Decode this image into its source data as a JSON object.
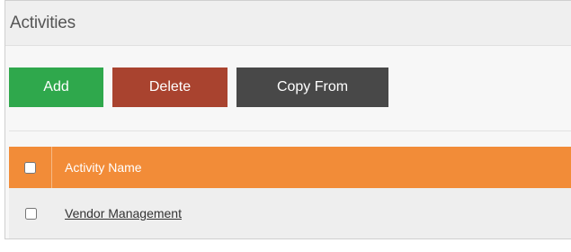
{
  "panel": {
    "title": "Activities"
  },
  "toolbar": {
    "add_label": "Add",
    "delete_label": "Delete",
    "copy_from_label": "Copy From"
  },
  "colors": {
    "add": "#2fa84c",
    "delete": "#a9432f",
    "copy_from": "#484848",
    "table_header": "#f28c38"
  },
  "table": {
    "columns": [
      "Activity Name"
    ],
    "rows": [
      {
        "name": "Vendor Management"
      }
    ]
  }
}
